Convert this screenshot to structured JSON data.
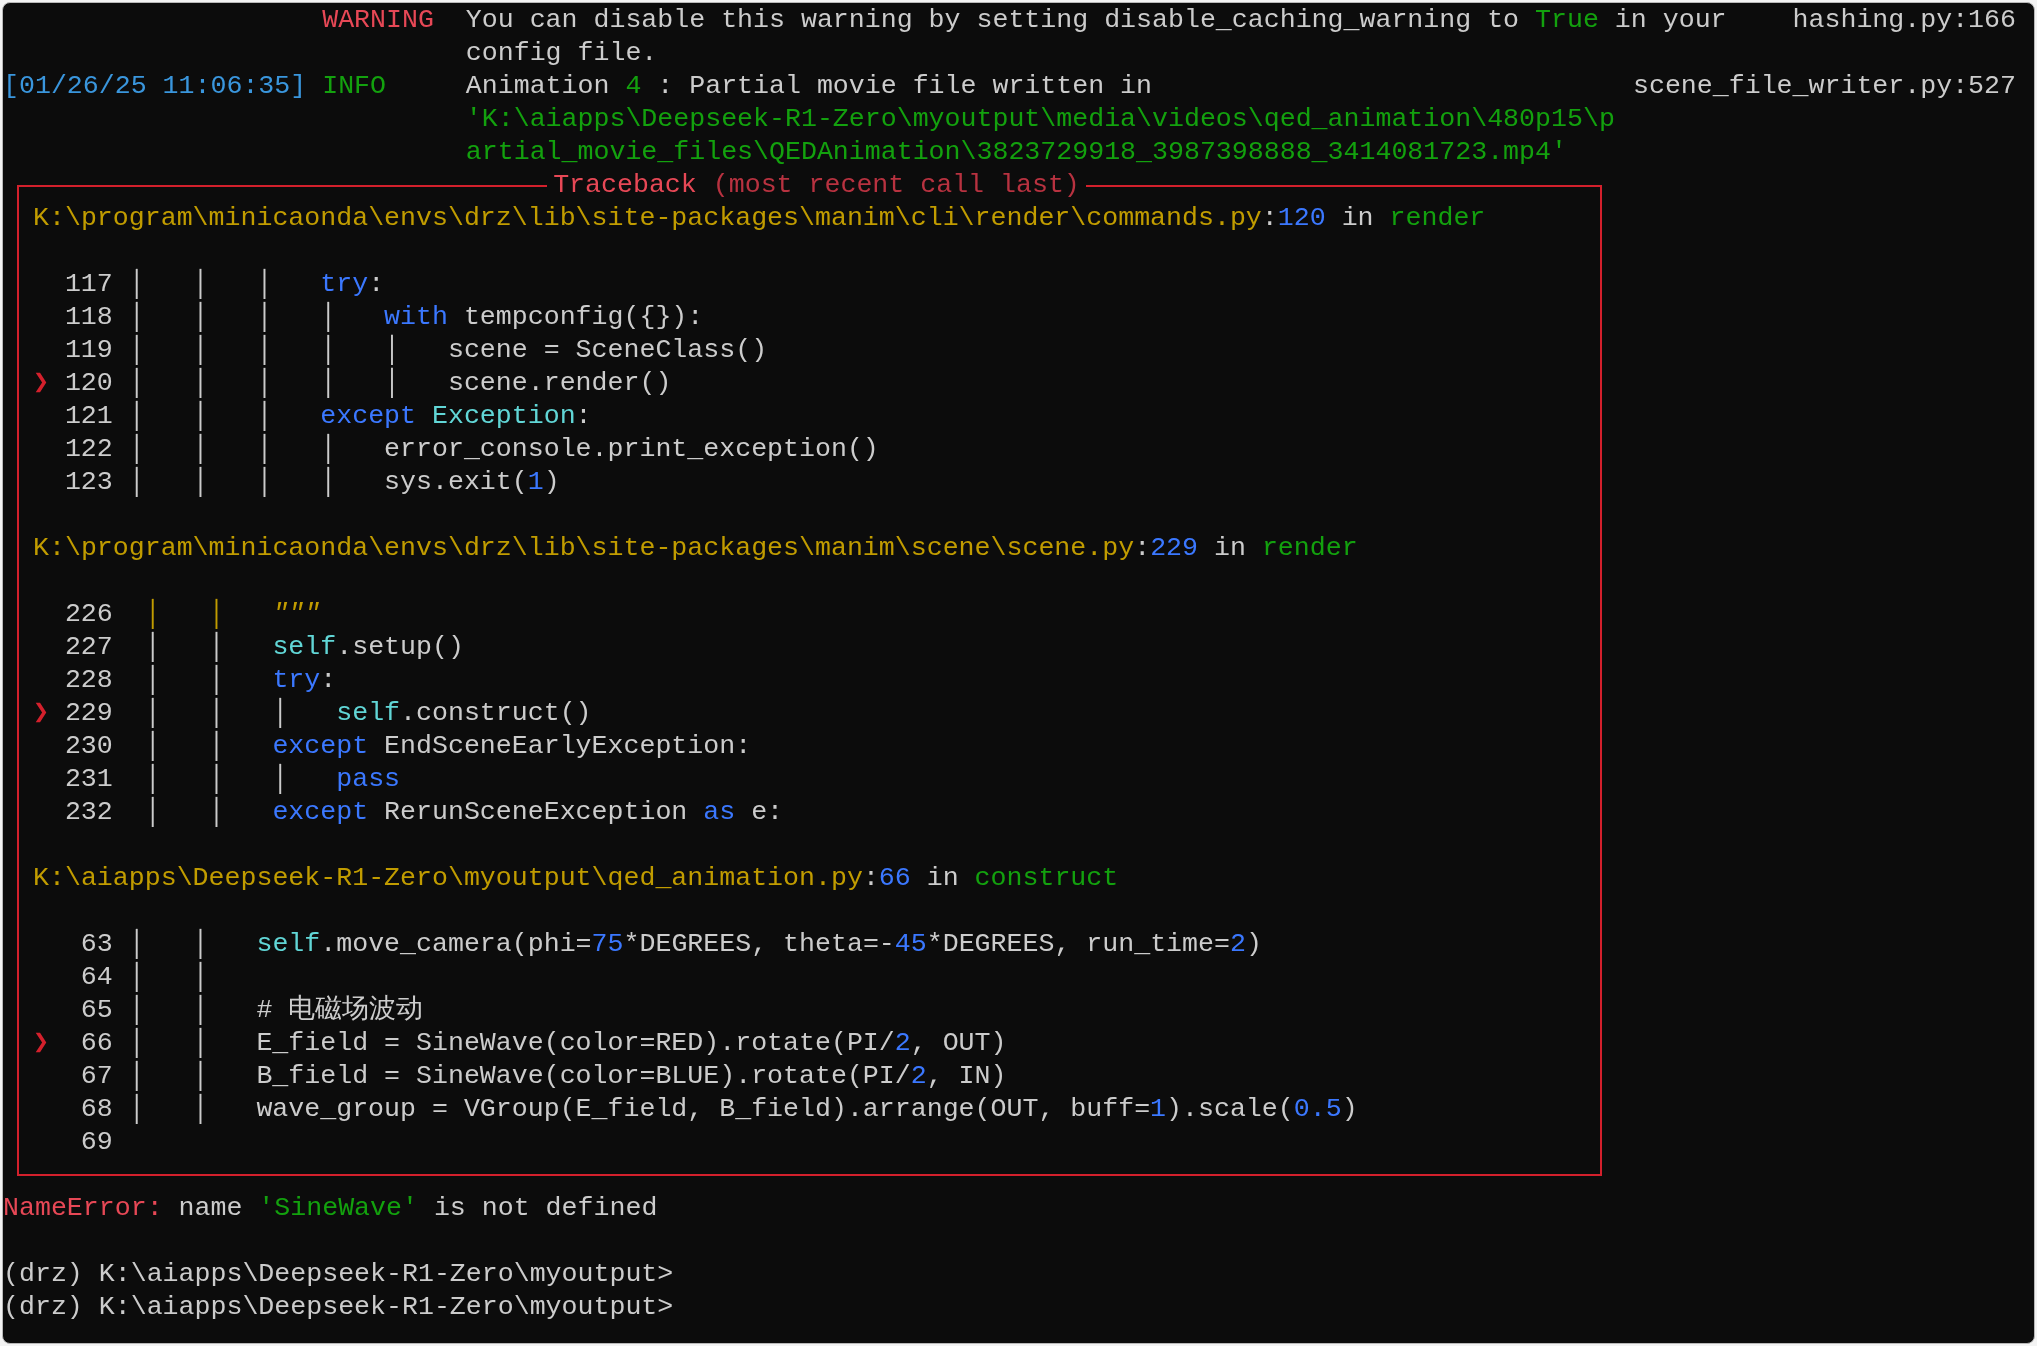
{
  "log": [
    {
      "level": "WARNING",
      "kind": "warning",
      "message": [
        [
          {
            "kind": "plain",
            "text": "You can disable this warning by setting disable_caching_warning to "
          },
          {
            "kind": "green",
            "text": "True"
          },
          {
            "kind": "plain",
            "text": " in your"
          }
        ],
        [
          {
            "kind": "plain",
            "text": "config file."
          }
        ]
      ],
      "source": "hashing.py:166"
    },
    {
      "time": "[01/26/25 11:06:35]",
      "level": "INFO",
      "kind": "info",
      "message": [
        [
          {
            "kind": "plain",
            "text": "Animation "
          },
          {
            "kind": "green",
            "text": "4"
          },
          {
            "kind": "plain",
            "text": " : Partial movie file written in"
          }
        ],
        [
          {
            "kind": "green",
            "text": "'K:\\aiapps\\Deepseek-R1-Zero\\myoutput\\media\\videos\\qed_animation\\480p15\\p"
          }
        ],
        [
          {
            "kind": "green",
            "text": "artial_movie_files\\QEDAnimation\\3823729918_3987398888_3414081723.mp4'"
          }
        ]
      ],
      "source": "scene_file_writer.py:527"
    }
  ],
  "traceback": {
    "title": "Traceback",
    "subtitle": "(most recent call last)",
    "marker": "❯",
    "frames": [
      {
        "header": [
          {
            "kind": "path",
            "text": "K:\\program\\minicaonda\\envs\\drz\\lib\\site-packages\\manim\\cli\\render\\commands.py"
          },
          {
            "kind": "plain",
            "text": ":"
          },
          {
            "kind": "num",
            "text": "120"
          },
          {
            "kind": "plain",
            "text": " in "
          },
          {
            "kind": "func",
            "text": "render"
          }
        ],
        "lines": [
          {
            "number": "117",
            "current": false,
            "segments": [
              {
                "kind": "plain",
                "text": " │   │   │   "
              },
              {
                "kind": "kw",
                "text": "try"
              },
              {
                "kind": "plain",
                "text": ":"
              }
            ]
          },
          {
            "number": "118",
            "current": false,
            "segments": [
              {
                "kind": "plain",
                "text": " │   │   │   │   "
              },
              {
                "kind": "kw",
                "text": "with"
              },
              {
                "kind": "plain",
                "text": " tempconfig({}):"
              }
            ]
          },
          {
            "number": "119",
            "current": false,
            "segments": [
              {
                "kind": "plain",
                "text": " │   │   │   │   │   scene = SceneClass()"
              }
            ]
          },
          {
            "number": "120",
            "current": true,
            "segments": [
              {
                "kind": "plain",
                "text": " │   │   │   │   │   scene.render()"
              }
            ]
          },
          {
            "number": "121",
            "current": false,
            "segments": [
              {
                "kind": "plain",
                "text": " │   │   │   "
              },
              {
                "kind": "kw",
                "text": "except"
              },
              {
                "kind": "name",
                "text": " Exception"
              },
              {
                "kind": "plain",
                "text": ":"
              }
            ]
          },
          {
            "number": "122",
            "current": false,
            "segments": [
              {
                "kind": "plain",
                "text": " │   │   │   │   error_console.print_exception()"
              }
            ]
          },
          {
            "number": "123",
            "current": false,
            "segments": [
              {
                "kind": "plain",
                "text": " │   │   │   │   sys.exit("
              },
              {
                "kind": "num",
                "text": "1"
              },
              {
                "kind": "plain",
                "text": ")"
              }
            ]
          }
        ]
      },
      {
        "header": [
          {
            "kind": "path",
            "text": "K:\\program\\minicaonda\\envs\\drz\\lib\\site-packages\\manim\\scene\\scene.py"
          },
          {
            "kind": "plain",
            "text": ":"
          },
          {
            "kind": "num",
            "text": "229"
          },
          {
            "kind": "plain",
            "text": " in "
          },
          {
            "kind": "func",
            "text": "render"
          }
        ],
        "lines": [
          {
            "number": "226",
            "current": false,
            "segments": [
              {
                "kind": "str",
                "text": "  │   │   "
              },
              {
                "kind": "doc",
                "text": "\"\"\""
              }
            ]
          },
          {
            "number": "227",
            "current": false,
            "segments": [
              {
                "kind": "plain",
                "text": "  │   │   "
              },
              {
                "kind": "name",
                "text": "self"
              },
              {
                "kind": "plain",
                "text": ".setup()"
              }
            ]
          },
          {
            "number": "228",
            "current": false,
            "segments": [
              {
                "kind": "plain",
                "text": "  │   │   "
              },
              {
                "kind": "kw",
                "text": "try"
              },
              {
                "kind": "plain",
                "text": ":"
              }
            ]
          },
          {
            "number": "229",
            "current": true,
            "segments": [
              {
                "kind": "plain",
                "text": "  │   │   │   "
              },
              {
                "kind": "name",
                "text": "self"
              },
              {
                "kind": "plain",
                "text": ".construct()"
              }
            ]
          },
          {
            "number": "230",
            "current": false,
            "segments": [
              {
                "kind": "plain",
                "text": "  │   │   "
              },
              {
                "kind": "kw",
                "text": "except"
              },
              {
                "kind": "plain",
                "text": " EndSceneEarlyException:"
              }
            ]
          },
          {
            "number": "231",
            "current": false,
            "segments": [
              {
                "kind": "plain",
                "text": "  │   │   │   "
              },
              {
                "kind": "kw",
                "text": "pass"
              }
            ]
          },
          {
            "number": "232",
            "current": false,
            "segments": [
              {
                "kind": "plain",
                "text": "  │   │   "
              },
              {
                "kind": "kw",
                "text": "except"
              },
              {
                "kind": "plain",
                "text": " RerunSceneException "
              },
              {
                "kind": "kw",
                "text": "as"
              },
              {
                "kind": "plain",
                "text": " e:"
              }
            ]
          }
        ]
      },
      {
        "header": [
          {
            "kind": "path",
            "text": "K:\\aiapps\\Deepseek-R1-Zero\\myoutput\\qed_animation.py"
          },
          {
            "kind": "plain",
            "text": ":"
          },
          {
            "kind": "num",
            "text": "66"
          },
          {
            "kind": "plain",
            "text": " in "
          },
          {
            "kind": "func",
            "text": "construct"
          }
        ],
        "lines": [
          {
            "number": "63",
            "current": false,
            "segments": [
              {
                "kind": "plain",
                "text": " │   │   "
              },
              {
                "kind": "name",
                "text": "self"
              },
              {
                "kind": "plain",
                "text": ".move_camera(phi="
              },
              {
                "kind": "num",
                "text": "75"
              },
              {
                "kind": "plain",
                "text": "*DEGREES, theta=-"
              },
              {
                "kind": "num",
                "text": "45"
              },
              {
                "kind": "plain",
                "text": "*DEGREES, run_time="
              },
              {
                "kind": "num",
                "text": "2"
              },
              {
                "kind": "plain",
                "text": ")"
              }
            ]
          },
          {
            "number": "64",
            "current": false,
            "segments": [
              {
                "kind": "plain",
                "text": " │   │"
              }
            ]
          },
          {
            "number": "65",
            "current": false,
            "segments": [
              {
                "kind": "plain",
                "text": " │   │   # 电磁场波动"
              }
            ]
          },
          {
            "number": "66",
            "current": true,
            "segments": [
              {
                "kind": "plain",
                "text": " │   │   E_field = SineWave(color=RED).rotate(PI/"
              },
              {
                "kind": "num",
                "text": "2"
              },
              {
                "kind": "plain",
                "text": ", OUT)"
              }
            ]
          },
          {
            "number": "67",
            "current": false,
            "segments": [
              {
                "kind": "plain",
                "text": " │   │   B_field = SineWave(color=BLUE).rotate(PI/"
              },
              {
                "kind": "num",
                "text": "2"
              },
              {
                "kind": "plain",
                "text": ", IN)"
              }
            ]
          },
          {
            "number": "68",
            "current": false,
            "segments": [
              {
                "kind": "plain",
                "text": " │   │   wave_group = VGroup(E_field, B_field).arrange(OUT, buff="
              },
              {
                "kind": "num",
                "text": "1"
              },
              {
                "kind": "plain",
                "text": ").scale("
              },
              {
                "kind": "num",
                "text": "0.5"
              },
              {
                "kind": "plain",
                "text": ")"
              }
            ]
          },
          {
            "number": "69",
            "current": false
          }
        ]
      }
    ]
  },
  "error": [
    {
      "kind": "error",
      "text": "NameError:"
    },
    {
      "kind": "plain",
      "text": " name "
    },
    {
      "kind": "green",
      "text": "'SineWave'"
    },
    {
      "kind": "plain",
      "text": " is not defined"
    }
  ],
  "prompts": [
    "(drz) K:\\aiapps\\Deepseek-R1-Zero\\myoutput>",
    "(drz) K:\\aiapps\\Deepseek-R1-Zero\\myoutput>"
  ]
}
